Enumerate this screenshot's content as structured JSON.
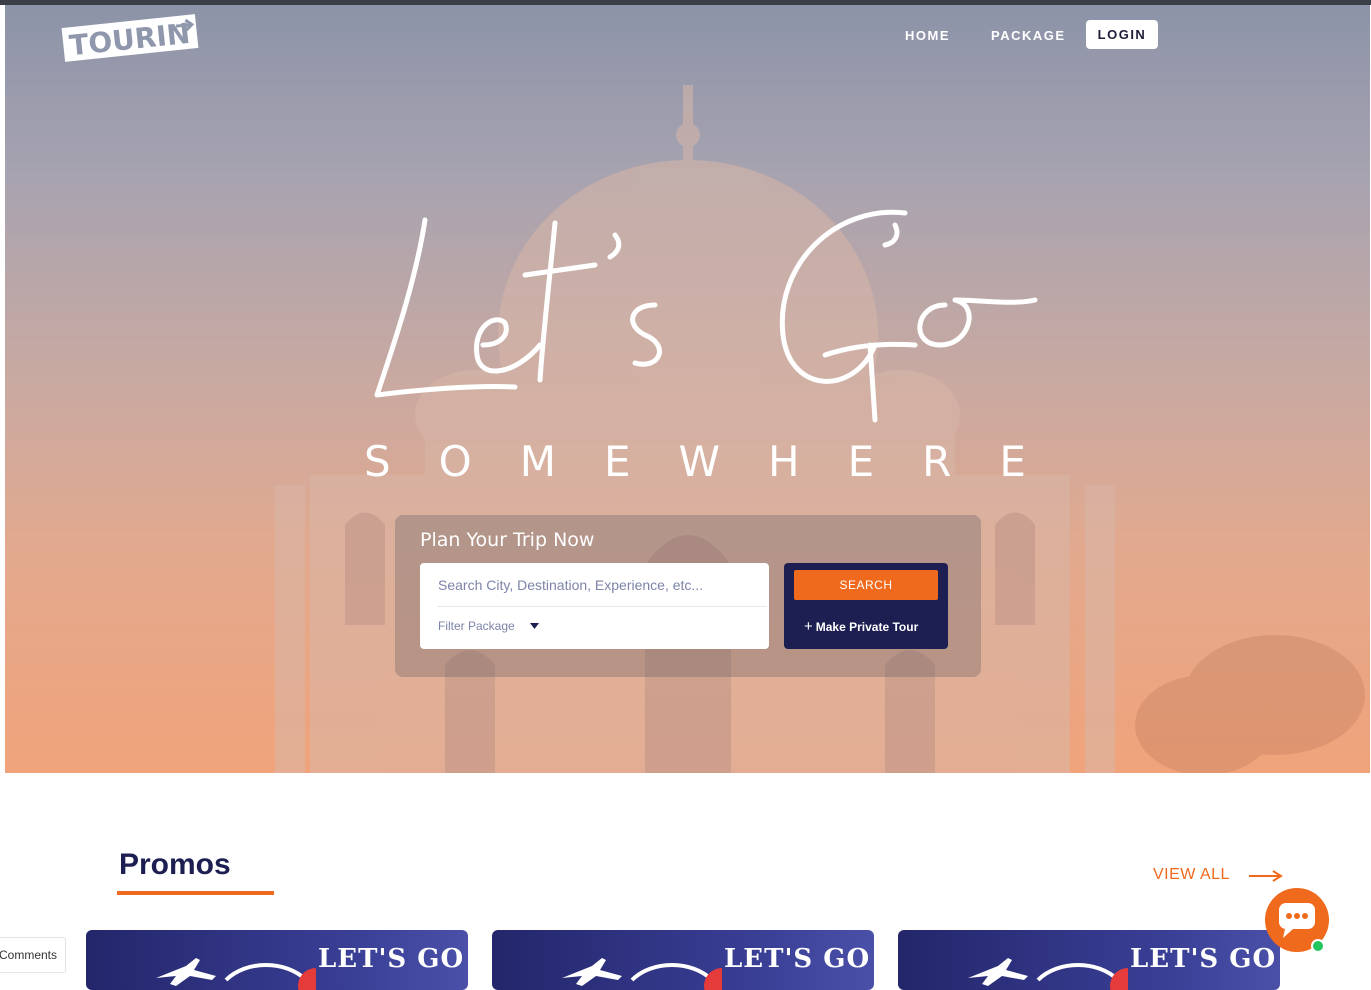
{
  "brand": {
    "logo_text": "TOURIN"
  },
  "nav": {
    "home": "HOME",
    "package": "PACKAGE",
    "login": "LOGIN"
  },
  "hero": {
    "headline": "Let's Go",
    "subheadline": "SOMEWHERE",
    "plan_title": "Plan Your Trip Now",
    "search_placeholder": "Search City, Destination, Experience, etc...",
    "filter_label": "Filter Package",
    "search_button": "SEARCH",
    "private_tour_button": "Make Private Tour"
  },
  "promos": {
    "title": "Promos",
    "view_all": "VIEW ALL",
    "cards": [
      {
        "banner_text": "LET'S GO"
      },
      {
        "banner_text": "LET'S GO"
      },
      {
        "banner_text": "LET'S GO"
      }
    ]
  },
  "widgets": {
    "comments_tab": "Comments",
    "chat_icon": "chat-icon"
  },
  "colors": {
    "accent": "#ef6a1c",
    "navy": "#1d1f52",
    "white": "#ffffff",
    "online": "#22c55e"
  }
}
